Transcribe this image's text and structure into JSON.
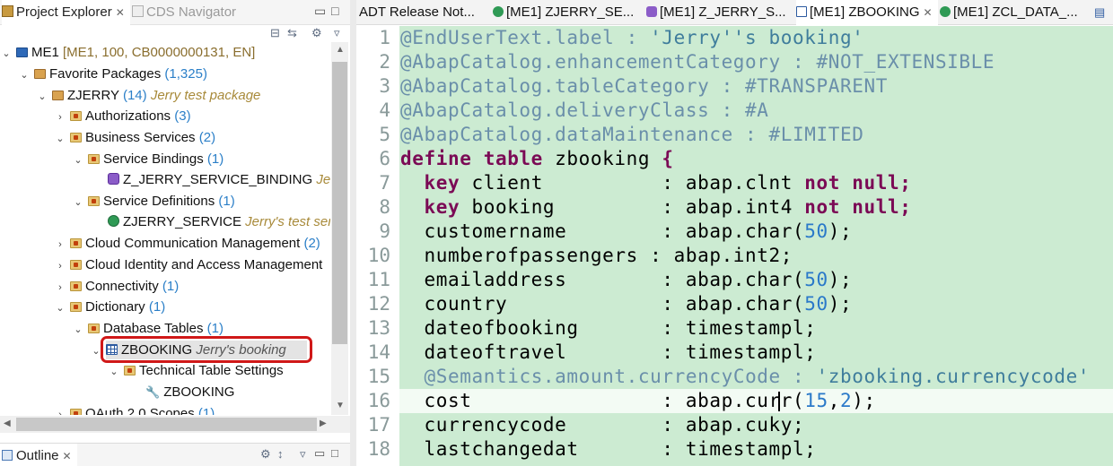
{
  "left": {
    "tabs": {
      "project_explorer": "Project Explorer",
      "cds_navigator": "CDS Navigator"
    },
    "outline_tab": "Outline",
    "tree": [
      {
        "id": "me1",
        "name": "ME1",
        "count": "",
        "desc": "[ME1, 100, CB0000000131, EN]"
      },
      {
        "id": "favorite_packages",
        "name": "Favorite Packages",
        "count": "(1,325)",
        "desc": ""
      },
      {
        "id": "zjerry",
        "name": "ZJERRY",
        "count": "(14)",
        "desc": "Jerry test package"
      },
      {
        "id": "authorizations",
        "name": "Authorizations",
        "count": "(3)",
        "desc": ""
      },
      {
        "id": "business_services",
        "name": "Business Services",
        "count": "(2)",
        "desc": ""
      },
      {
        "id": "service_bindings",
        "name": "Service Bindings",
        "count": "(1)",
        "desc": ""
      },
      {
        "id": "z_jerry_service_binding",
        "name": "Z_JERRY_SERVICE_BINDING",
        "count": "",
        "desc": "Jerry'"
      },
      {
        "id": "service_definitions",
        "name": "Service Definitions",
        "count": "(1)",
        "desc": ""
      },
      {
        "id": "zjerry_service",
        "name": "ZJERRY_SERVICE",
        "count": "",
        "desc": "Jerry's test servic"
      },
      {
        "id": "cloud_comm",
        "name": "Cloud Communication Management",
        "count": "(2)",
        "desc": ""
      },
      {
        "id": "cloud_identity",
        "name": "Cloud Identity and Access Management",
        "count": "",
        "desc": ""
      },
      {
        "id": "connectivity",
        "name": "Connectivity",
        "count": "(1)",
        "desc": ""
      },
      {
        "id": "dictionary",
        "name": "Dictionary",
        "count": "(1)",
        "desc": ""
      },
      {
        "id": "database_tables",
        "name": "Database Tables",
        "count": "(1)",
        "desc": ""
      },
      {
        "id": "zbooking",
        "name": "ZBOOKING",
        "count": "",
        "desc": "Jerry's booking"
      },
      {
        "id": "technical_table_settings",
        "name": "Technical Table Settings",
        "count": "",
        "desc": ""
      },
      {
        "id": "zbooking_settings",
        "name": "ZBOOKING",
        "count": "",
        "desc": ""
      },
      {
        "id": "oauth",
        "name": "OAuth 2.0 Scopes",
        "count": "(1)",
        "desc": ""
      }
    ]
  },
  "editor": {
    "tabs": [
      {
        "label": "ADT Release Not..."
      },
      {
        "label": "[ME1] ZJERRY_SE..."
      },
      {
        "label": "[ME1] Z_JERRY_S..."
      },
      {
        "label": "[ME1] ZBOOKING"
      },
      {
        "label": "[ME1] ZCL_DATA_..."
      }
    ],
    "line_numbers": [
      "1",
      "2",
      "3",
      "4",
      "5",
      "6",
      "7",
      "8",
      "9",
      "10",
      "11",
      "12",
      "13",
      "14",
      "15",
      "16",
      "17",
      "18"
    ],
    "lines": [
      [
        {
          "t": "ann",
          "v": "@EndUserText.label : "
        },
        {
          "t": "str",
          "v": "'Jerry''s booking'"
        }
      ],
      [
        {
          "t": "ann",
          "v": "@AbapCatalog.enhancementCategory : #NOT_EXTENSIBLE"
        }
      ],
      [
        {
          "t": "ann",
          "v": "@AbapCatalog.tableCategory : #TRANSPARENT"
        }
      ],
      [
        {
          "t": "ann",
          "v": "@AbapCatalog.deliveryClass : #A"
        }
      ],
      [
        {
          "t": "ann",
          "v": "@AbapCatalog.dataMaintenance : #LIMITED"
        }
      ],
      [
        {
          "t": "kw",
          "v": "define table"
        },
        {
          "t": "pl",
          "v": " zbooking "
        },
        {
          "t": "kw",
          "v": "{"
        }
      ],
      [
        {
          "t": "pl",
          "v": "  "
        },
        {
          "t": "kw",
          "v": "key"
        },
        {
          "t": "pl",
          "v": " client          : abap.clnt "
        },
        {
          "t": "kw",
          "v": "not null;"
        }
      ],
      [
        {
          "t": "pl",
          "v": "  "
        },
        {
          "t": "kw",
          "v": "key"
        },
        {
          "t": "pl",
          "v": " booking         : abap.int4 "
        },
        {
          "t": "kw",
          "v": "not null;"
        }
      ],
      [
        {
          "t": "pl",
          "v": "  customername        : abap.char("
        },
        {
          "t": "num",
          "v": "50"
        },
        {
          "t": "pl",
          "v": ");"
        }
      ],
      [
        {
          "t": "pl",
          "v": "  numberofpassengers : abap.int2;"
        }
      ],
      [
        {
          "t": "pl",
          "v": "  emailaddress        : abap.char("
        },
        {
          "t": "num",
          "v": "50"
        },
        {
          "t": "pl",
          "v": ");"
        }
      ],
      [
        {
          "t": "pl",
          "v": "  country             : abap.char("
        },
        {
          "t": "num",
          "v": "50"
        },
        {
          "t": "pl",
          "v": ");"
        }
      ],
      [
        {
          "t": "pl",
          "v": "  dateofbooking       : timestampl;"
        }
      ],
      [
        {
          "t": "pl",
          "v": "  dateoftravel        : timestampl;"
        }
      ],
      [
        {
          "t": "pl",
          "v": "  "
        },
        {
          "t": "ann",
          "v": "@Semantics.amount.currencyCode : "
        },
        {
          "t": "str",
          "v": "'zbooking.currencycode'"
        }
      ],
      [
        {
          "t": "pl",
          "v": "  cost                : abap.curr("
        },
        {
          "t": "num",
          "v": "15"
        },
        {
          "t": "pl",
          "v": ","
        },
        {
          "t": "num",
          "v": "2"
        },
        {
          "t": "pl",
          "v": ");"
        }
      ],
      [
        {
          "t": "pl",
          "v": "  currencycode        : abap.cuky;"
        }
      ],
      [
        {
          "t": "pl",
          "v": "  lastchangedat       : timestampl;"
        }
      ]
    ]
  },
  "colors": {
    "code_bg": "#ccebd2",
    "keyword": "#7b0a55",
    "annotation": "#6a8faa",
    "number": "#2a79c9",
    "highlight": "#d01818"
  },
  "icons": [
    "folder-icon",
    "package-icon",
    "system-icon",
    "service-binding-icon",
    "service-definition-icon",
    "table-icon",
    "wrench-icon",
    "close-icon"
  ]
}
